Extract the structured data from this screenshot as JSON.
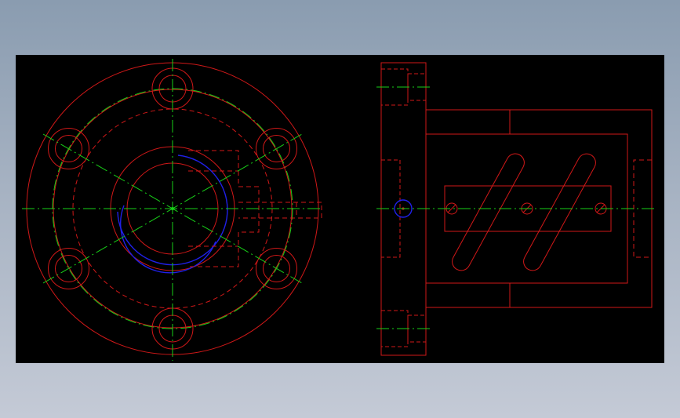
{
  "colors": {
    "background": "#000000",
    "outline": "#d01818",
    "center_line": "#18d018",
    "highlight": "#2020e8",
    "page_gradient_top": "#8a9cb0",
    "page_gradient_bottom": "#c4cad6"
  },
  "views": [
    "front-view",
    "side-view"
  ],
  "front_view": {
    "bolt_hole_count": 6
  },
  "side_view": {
    "slot_count": 2,
    "pin_count": 3
  }
}
